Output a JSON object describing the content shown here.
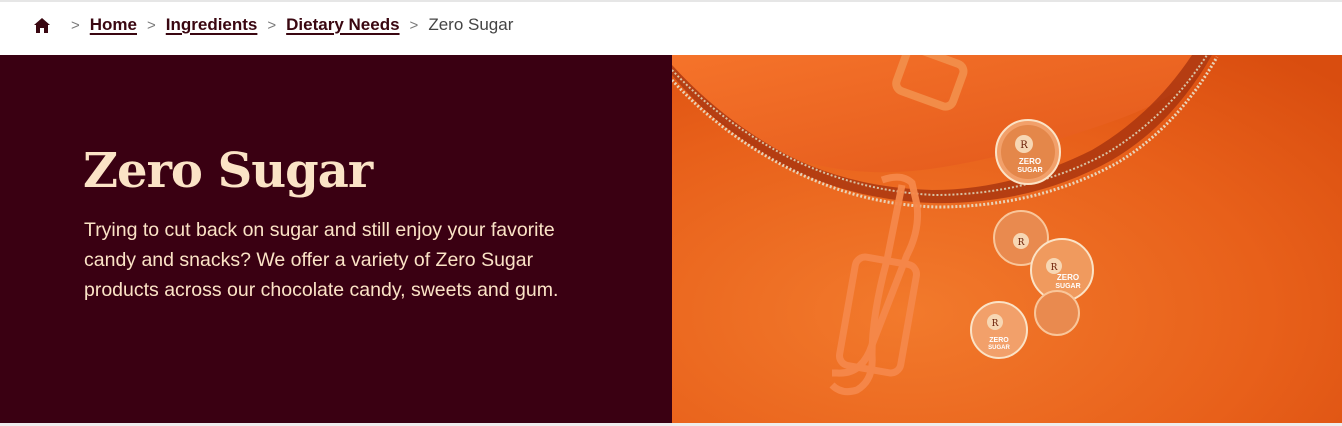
{
  "breadcrumb": {
    "home_icon": "home-icon",
    "separator": ">",
    "items": [
      {
        "label": "Home"
      },
      {
        "label": "Ingredients"
      },
      {
        "label": "Dietary Needs"
      }
    ],
    "current": "Zero Sugar"
  },
  "hero": {
    "title": "Zero Sugar",
    "description": "Trying to cut back on sugar and still enjoy your favorite candy and snacks? We offer a variety of Zero Sugar products across our chocolate candy, sweets and gum.",
    "image": {
      "candy_label": "ZERO SUGAR",
      "candy_logo": "R"
    }
  },
  "colors": {
    "maroon": "#3a0012",
    "cream": "#fbe3c6",
    "orange": "#ec5a12"
  }
}
